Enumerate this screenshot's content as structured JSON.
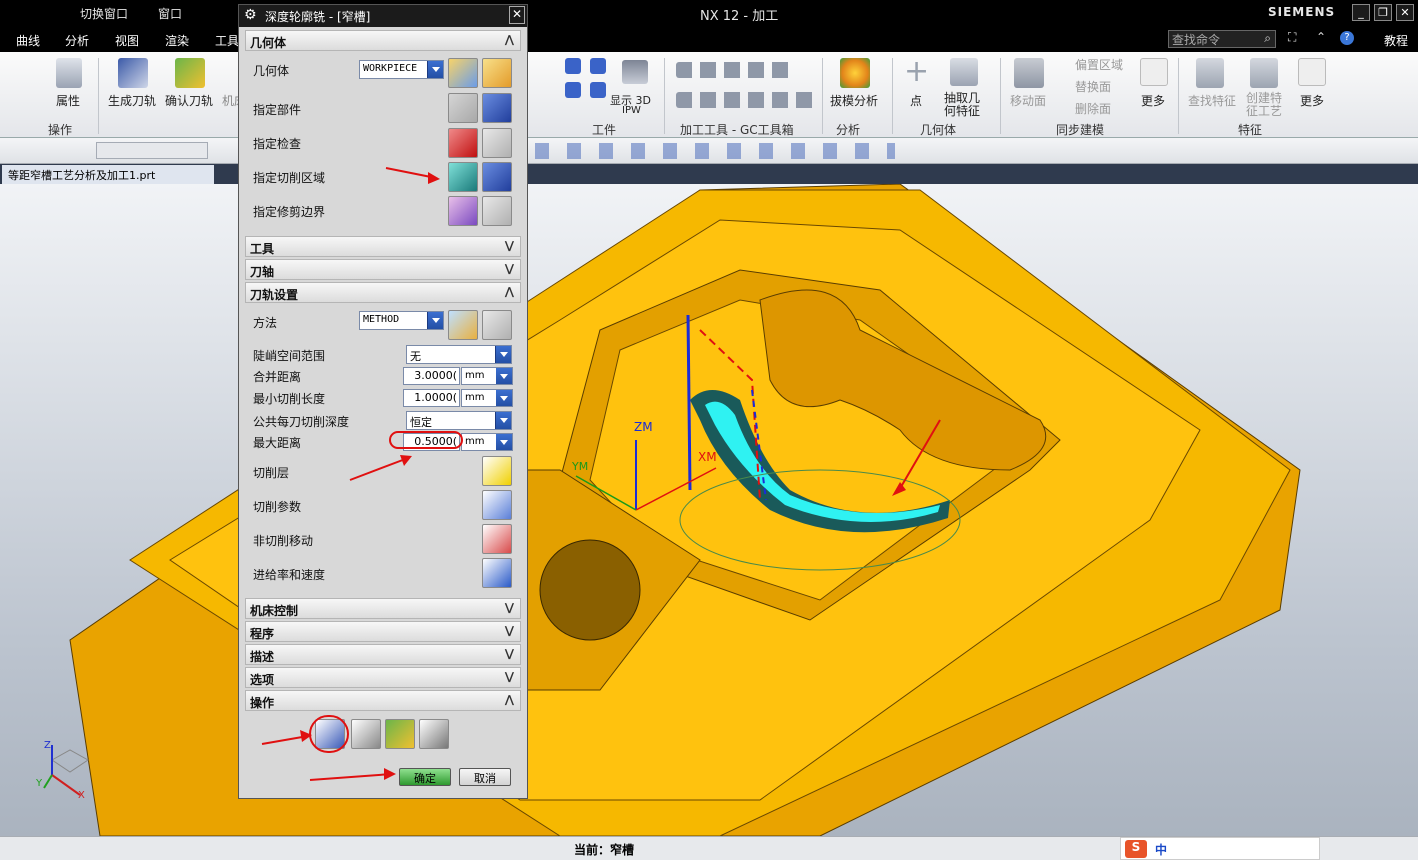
{
  "titlebar": {
    "switch_window": "切换窗口",
    "window_menu": "窗口",
    "app_title": "NX 12 - 加工",
    "brand": "SIEMENS"
  },
  "menubar": {
    "items": [
      "曲线",
      "分析",
      "视图",
      "渲染",
      "工具"
    ],
    "search_placeholder": "查找命令",
    "tutorial": "教程"
  },
  "ribbon": {
    "attr": "属性",
    "gen_path": "生成刀轨",
    "confirm_path": "确认刀轨",
    "mach_short": "机床",
    "op_group": "操作",
    "show3d": "显示 3D",
    "ipw": "IPW",
    "workpiece_group": "工件",
    "mach_tools_group": "加工工具 - GC工具箱",
    "draft_analysis": "拔模分析",
    "analysis_group": "分析",
    "point": "点",
    "extract_geom": "抽取几何特征",
    "geometry_group": "几何体",
    "offset_region": "偏置区域",
    "replace_face": "替换面",
    "delete_face": "删除面",
    "move_face": "移动面",
    "more": "更多",
    "sync_group": "同步建模",
    "find_feature": "查找特征",
    "create_feature_process": "创建特征工艺",
    "more2": "更多",
    "feature_group": "特征"
  },
  "tab": {
    "filename": "等距窄槽工艺分析及加工1.prt"
  },
  "dialog": {
    "title": "深度轮廓铣 - [窄槽]",
    "sections": {
      "geometry": "几何体",
      "tool": "工具",
      "axis": "刀轴",
      "path_settings": "刀轨设置",
      "machine_control": "机床控制",
      "program": "程序",
      "description": "描述",
      "options": "选项",
      "actions": "操作"
    },
    "geometry_label": "几何体",
    "geometry_value": "WORKPIECE",
    "spec_part": "指定部件",
    "spec_check": "指定检查",
    "spec_cut_area": "指定切削区域",
    "spec_trim": "指定修剪边界",
    "method_label": "方法",
    "method_value": "METHOD",
    "steep_range_label": "陡峭空间范围",
    "steep_range_value": "无",
    "merge_dist_label": "合并距离",
    "merge_dist_value": "3.0000(",
    "merge_unit": "mm",
    "min_cut_len_label": "最小切削长度",
    "min_cut_len_value": "1.0000(",
    "min_unit": "mm",
    "common_depth_label": "公共每刀切削深度",
    "common_depth_value": "恒定",
    "max_dist_label": "最大距离",
    "max_dist_value": "0.5000(",
    "max_unit": "mm",
    "cut_levels": "切削层",
    "cut_params": "切削参数",
    "non_cut_moves": "非切削移动",
    "feeds_speeds": "进给率和速度",
    "ok": "确定",
    "cancel": "取消"
  },
  "viewport": {
    "zm": "ZM",
    "xm": "XM",
    "ym": "YM",
    "triad_z": "Z",
    "triad_x": "X",
    "triad_y": "Y"
  },
  "statusbar": {
    "current": "当前：窄槽",
    "ime": "中"
  }
}
